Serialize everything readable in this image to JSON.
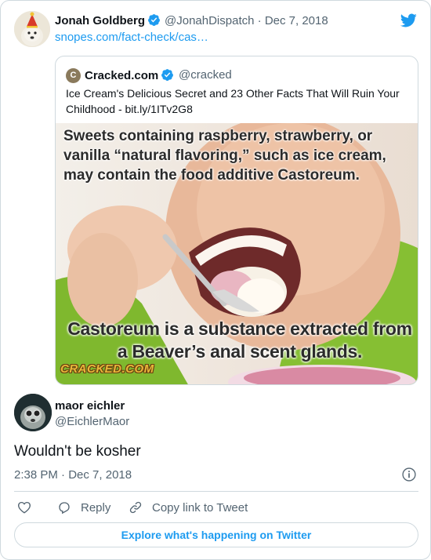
{
  "quoted_header": {
    "name": "Jonah Goldberg",
    "handle": "@JonahDispatch",
    "date": "Dec 7, 2018",
    "link": "snopes.com/fact-check/cas…"
  },
  "quoted_card": {
    "avatar_letter": "C",
    "name": "Cracked.com",
    "handle": "@cracked",
    "text": "Ice Cream's Delicious Secret and 23 Other Facts That Will Ruin Your Childhood - bit.ly/1ITv2G8",
    "image_top_caption": "Sweets containing raspberry, strawberry, or vanilla “natural flavoring,” such as ice cream, may contain the food additive Castoreum.",
    "image_bottom_caption": "Castoreum is a substance extracted from a Beaver’s anal scent glands.",
    "image_watermark": "CRACKED.COM"
  },
  "tweet": {
    "name": "maor eichler",
    "handle": "@EichlerMaor",
    "text": "Wouldn't be kosher",
    "time": "2:38 PM",
    "date": "Dec 7, 2018"
  },
  "actions": {
    "reply": "Reply",
    "copy_link": "Copy link to Tweet"
  },
  "explore_label": "Explore what's happening on Twitter",
  "colors": {
    "accent": "#1d9bf0",
    "secondary_text": "#536471",
    "border": "#cfd9de"
  },
  "icons": [
    "twitter-bird-icon",
    "verified-badge-icon",
    "info-icon",
    "heart-icon",
    "reply-bubble-icon",
    "link-icon"
  ]
}
